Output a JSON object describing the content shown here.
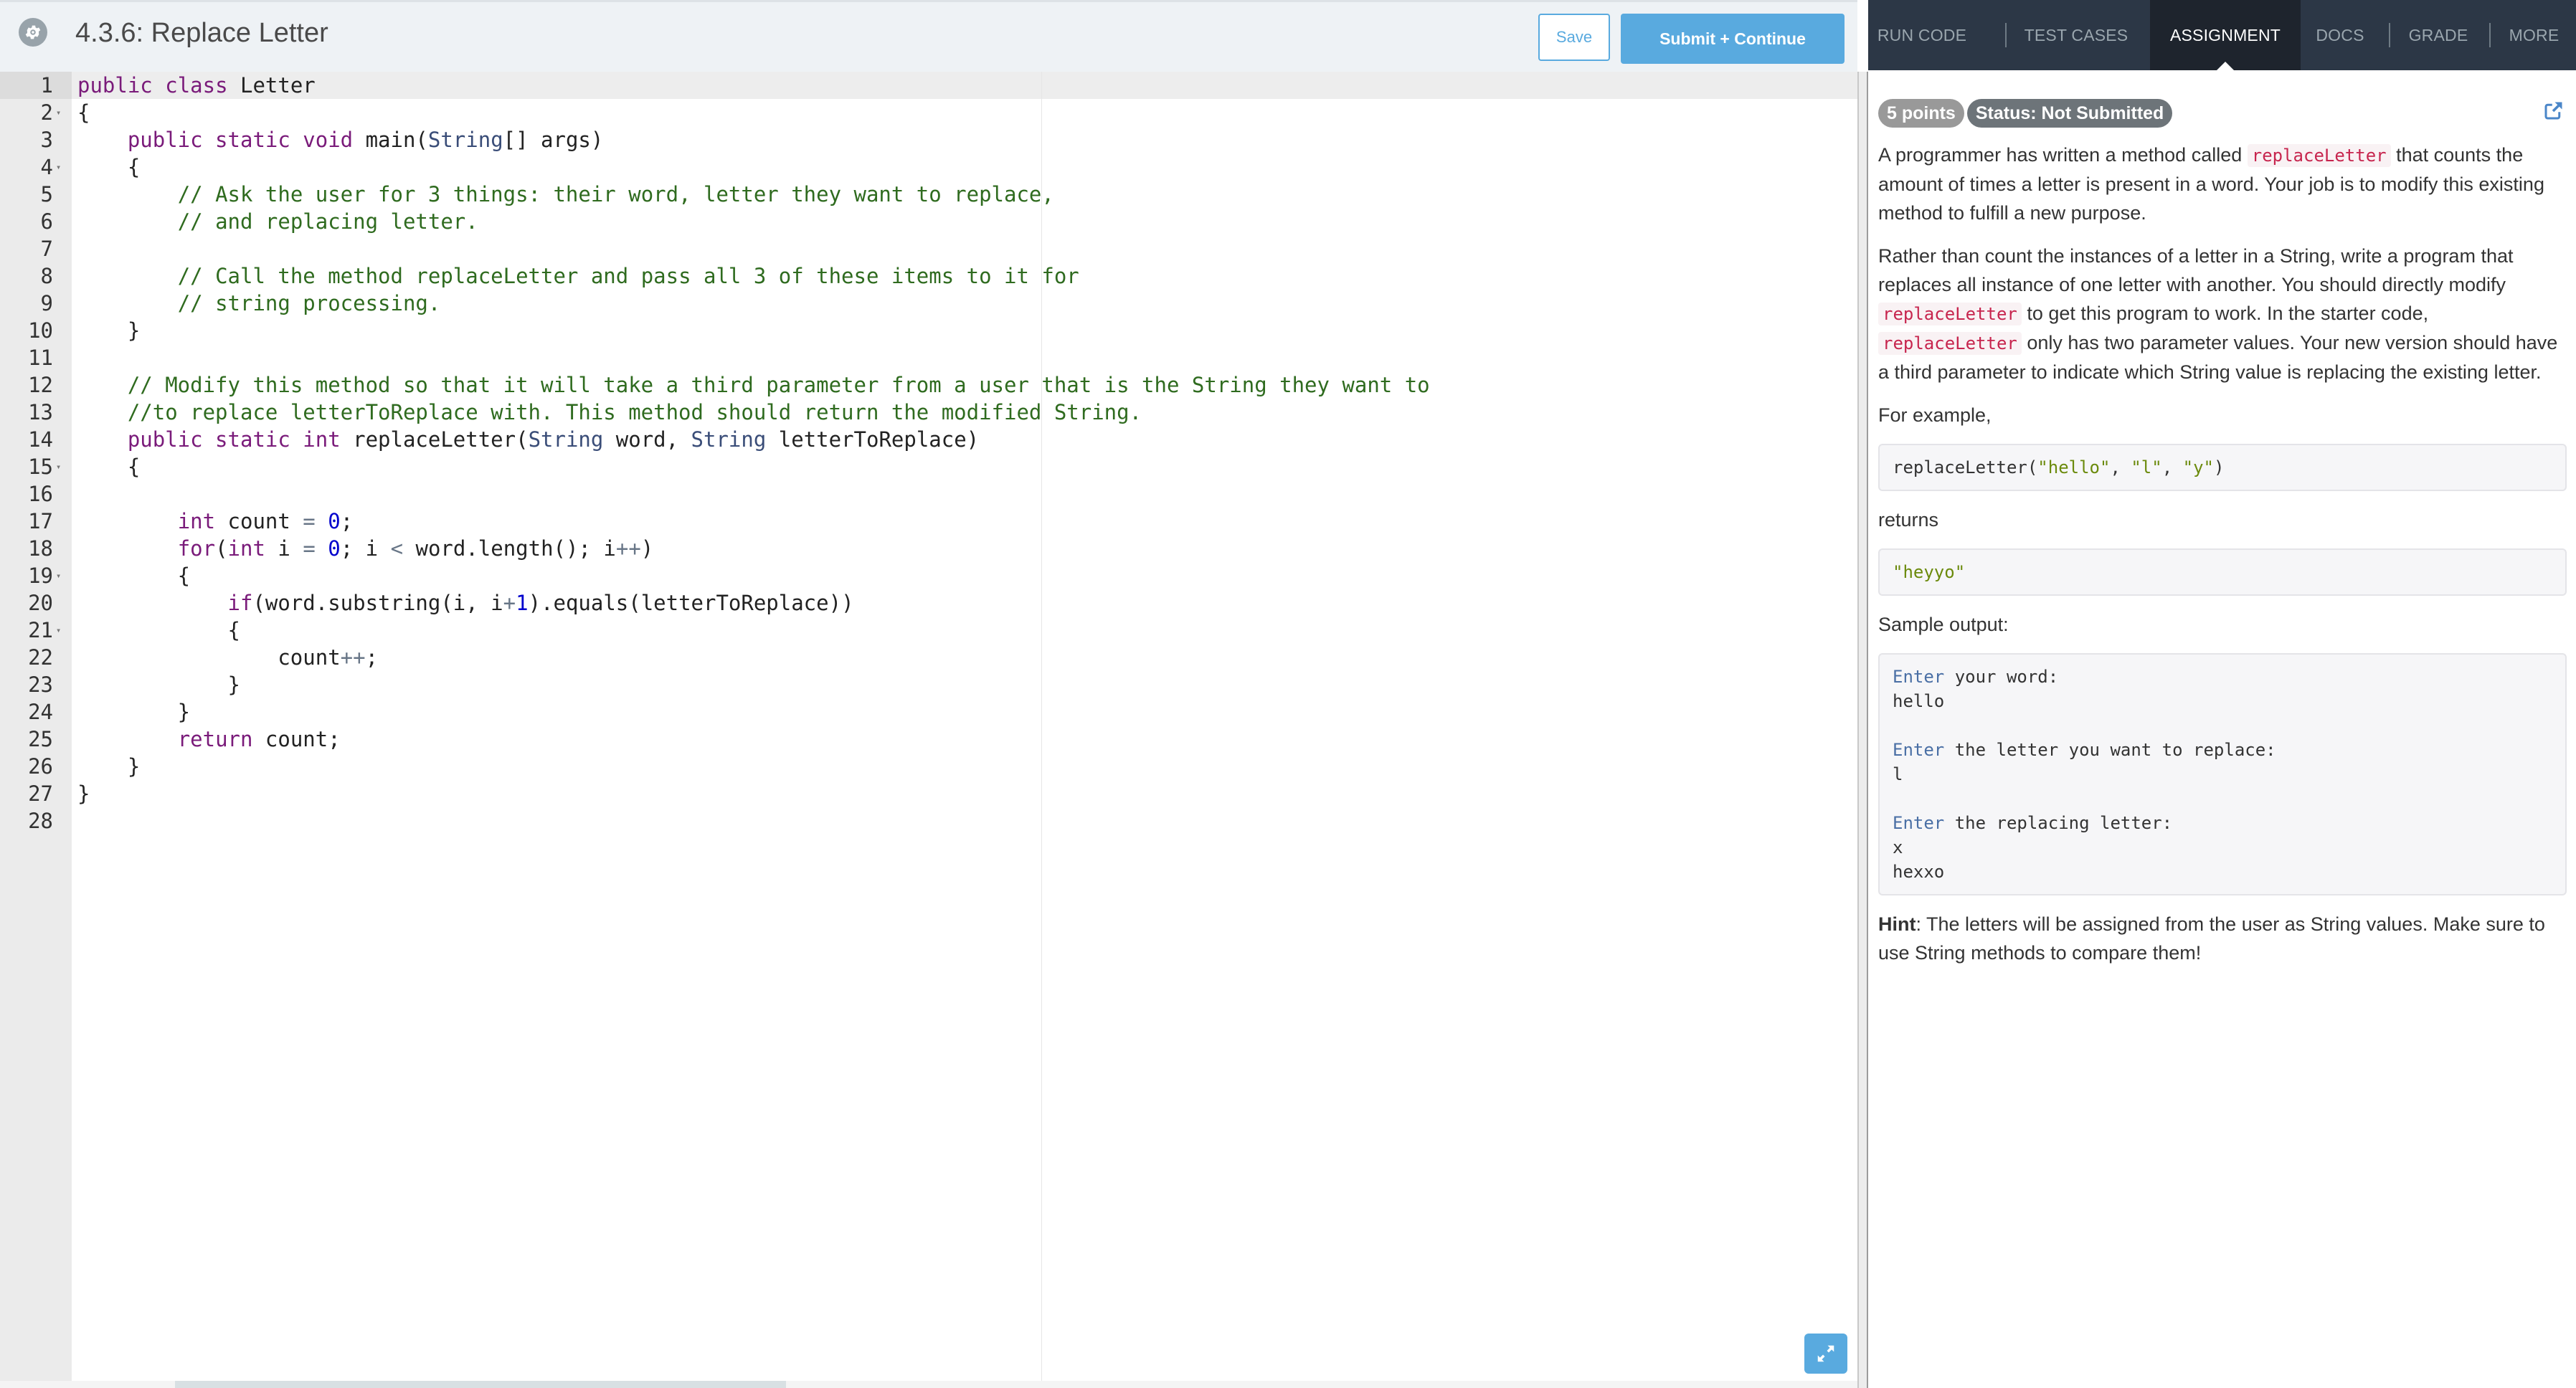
{
  "header": {
    "title": "4.3.6: Replace Letter",
    "save_label": "Save",
    "submit_label": "Submit + Continue"
  },
  "editor": {
    "lines": [
      {
        "n": "1",
        "fold": false,
        "tokens": [
          [
            "kw",
            "public"
          ],
          [
            "",
            ""
          ],
          [
            "",
            " "
          ],
          [
            "kw",
            "class"
          ],
          [
            "",
            " Letter"
          ]
        ]
      },
      {
        "n": "2",
        "fold": true,
        "tokens": [
          [
            "",
            "{"
          ]
        ]
      },
      {
        "n": "3",
        "fold": false,
        "tokens": [
          [
            "",
            "    "
          ],
          [
            "kw",
            "public static void"
          ],
          [
            "",
            " main("
          ],
          [
            "ty",
            "String"
          ],
          [
            "",
            "[] args)"
          ]
        ]
      },
      {
        "n": "4",
        "fold": true,
        "tokens": [
          [
            "",
            "    {"
          ]
        ]
      },
      {
        "n": "5",
        "fold": false,
        "tokens": [
          [
            "",
            "        "
          ],
          [
            "cm",
            "// Ask the user for 3 things: their word, letter they want to replace,"
          ]
        ]
      },
      {
        "n": "6",
        "fold": false,
        "tokens": [
          [
            "",
            "        "
          ],
          [
            "cm",
            "// and replacing letter."
          ]
        ]
      },
      {
        "n": "7",
        "fold": false,
        "tokens": []
      },
      {
        "n": "8",
        "fold": false,
        "tokens": [
          [
            "",
            "        "
          ],
          [
            "cm",
            "// Call the method replaceLetter and pass all 3 of these items to it for"
          ]
        ]
      },
      {
        "n": "9",
        "fold": false,
        "tokens": [
          [
            "",
            "        "
          ],
          [
            "cm",
            "// string processing."
          ]
        ]
      },
      {
        "n": "10",
        "fold": false,
        "tokens": [
          [
            "",
            "    }"
          ]
        ]
      },
      {
        "n": "11",
        "fold": false,
        "tokens": []
      },
      {
        "n": "12",
        "fold": false,
        "tokens": [
          [
            "",
            "    "
          ],
          [
            "cm",
            "// Modify this method so that it will take a third parameter from a user that is the String they want to"
          ]
        ]
      },
      {
        "n": "13",
        "fold": false,
        "tokens": [
          [
            "",
            "    "
          ],
          [
            "cm",
            "//to replace letterToReplace with. This method should return the modified String."
          ]
        ]
      },
      {
        "n": "14",
        "fold": false,
        "tokens": [
          [
            "",
            "    "
          ],
          [
            "kw",
            "public static int"
          ],
          [
            "",
            " replaceLetter("
          ],
          [
            "ty",
            "String"
          ],
          [
            "",
            " word, "
          ],
          [
            "ty",
            "String"
          ],
          [
            "",
            " letterToReplace)"
          ]
        ]
      },
      {
        "n": "15",
        "fold": true,
        "tokens": [
          [
            "",
            "    {"
          ]
        ]
      },
      {
        "n": "16",
        "fold": false,
        "tokens": []
      },
      {
        "n": "17",
        "fold": false,
        "tokens": [
          [
            "",
            "        "
          ],
          [
            "kw",
            "int"
          ],
          [
            "",
            " count "
          ],
          [
            "op",
            "="
          ],
          [
            "",
            " "
          ],
          [
            "nm",
            "0"
          ],
          [
            "",
            ";"
          ]
        ]
      },
      {
        "n": "18",
        "fold": false,
        "tokens": [
          [
            "",
            "        "
          ],
          [
            "kw",
            "for"
          ],
          [
            "",
            "("
          ],
          [
            "kw",
            "int"
          ],
          [
            "",
            " i "
          ],
          [
            "op",
            "="
          ],
          [
            "",
            " "
          ],
          [
            "nm",
            "0"
          ],
          [
            "",
            "; i "
          ],
          [
            "op",
            "<"
          ],
          [
            "",
            " word.length(); i"
          ],
          [
            "op",
            "++"
          ],
          [
            "",
            ")"
          ]
        ]
      },
      {
        "n": "19",
        "fold": true,
        "tokens": [
          [
            "",
            "        {"
          ]
        ]
      },
      {
        "n": "20",
        "fold": false,
        "tokens": [
          [
            "",
            "            "
          ],
          [
            "kw",
            "if"
          ],
          [
            "",
            "(word.substring(i, i"
          ],
          [
            "op",
            "+"
          ],
          [
            "nm",
            "1"
          ],
          [
            "",
            ").equals(letterToReplace))"
          ]
        ]
      },
      {
        "n": "21",
        "fold": true,
        "tokens": [
          [
            "",
            "            {"
          ]
        ]
      },
      {
        "n": "22",
        "fold": false,
        "tokens": [
          [
            "",
            "                count"
          ],
          [
            "op",
            "++"
          ],
          [
            "",
            ";"
          ]
        ]
      },
      {
        "n": "23",
        "fold": false,
        "tokens": [
          [
            "",
            "            }"
          ]
        ]
      },
      {
        "n": "24",
        "fold": false,
        "tokens": [
          [
            "",
            "        }"
          ]
        ]
      },
      {
        "n": "25",
        "fold": false,
        "tokens": [
          [
            "",
            "        "
          ],
          [
            "kw",
            "return"
          ],
          [
            "",
            " count;"
          ]
        ]
      },
      {
        "n": "26",
        "fold": false,
        "tokens": [
          [
            "",
            "    }"
          ]
        ]
      },
      {
        "n": "27",
        "fold": false,
        "tokens": [
          [
            "",
            "}"
          ]
        ]
      },
      {
        "n": "28",
        "fold": false,
        "tokens": []
      }
    ]
  },
  "tabs": [
    {
      "label": "RUN CODE",
      "active": false
    },
    {
      "label": "TEST CASES",
      "active": false
    },
    {
      "label": "ASSIGNMENT",
      "active": true
    },
    {
      "label": "DOCS",
      "active": false
    },
    {
      "label": "GRADE",
      "active": false
    },
    {
      "label": "MORE",
      "active": false
    }
  ],
  "assignment": {
    "points": "5 points",
    "status": "Status: Not Submitted",
    "p1": [
      "A programmer has written a method called ",
      "replaceLetter",
      " that counts the amount of times a letter is present in a word. Your job is to modify this existing method to fulfill a new purpose."
    ],
    "p2": [
      "Rather than count the instances of a letter in a String, write a program that replaces all instance of one letter with another. You should directly modify ",
      "replaceLetter",
      " to get this program to work. In the starter code, ",
      "replaceLetter",
      " only has two parameter values. Your new version should have a third parameter to indicate which String value is replacing the existing letter."
    ],
    "for_example": "For example,",
    "example_call": [
      "replaceLetter(",
      "\"hello\"",
      ", ",
      "\"l\"",
      ", ",
      "\"y\"",
      ")"
    ],
    "returns": "returns",
    "example_return": "\"heyyo\"",
    "sample_output_label": "Sample output:",
    "sample_output": [
      [
        "Enter",
        " your word:"
      ],
      [
        "",
        "hello"
      ],
      [
        "",
        ""
      ],
      [
        "Enter",
        " the letter you want to replace:"
      ],
      [
        "",
        "l"
      ],
      [
        "",
        ""
      ],
      [
        "Enter",
        " the replacing letter:"
      ],
      [
        "",
        "x"
      ],
      [
        "",
        "hexxo"
      ]
    ],
    "hint_label": "Hint",
    "hint_text": ": The letters will be assigned from the user as String values. Make sure to use String methods to compare them!"
  },
  "colors": {
    "accent": "#59aadf",
    "tabbar": "#2c3746",
    "tab_active": "#1e242d",
    "comment": "#2f6b1f",
    "keyword": "#7a1b7a"
  }
}
